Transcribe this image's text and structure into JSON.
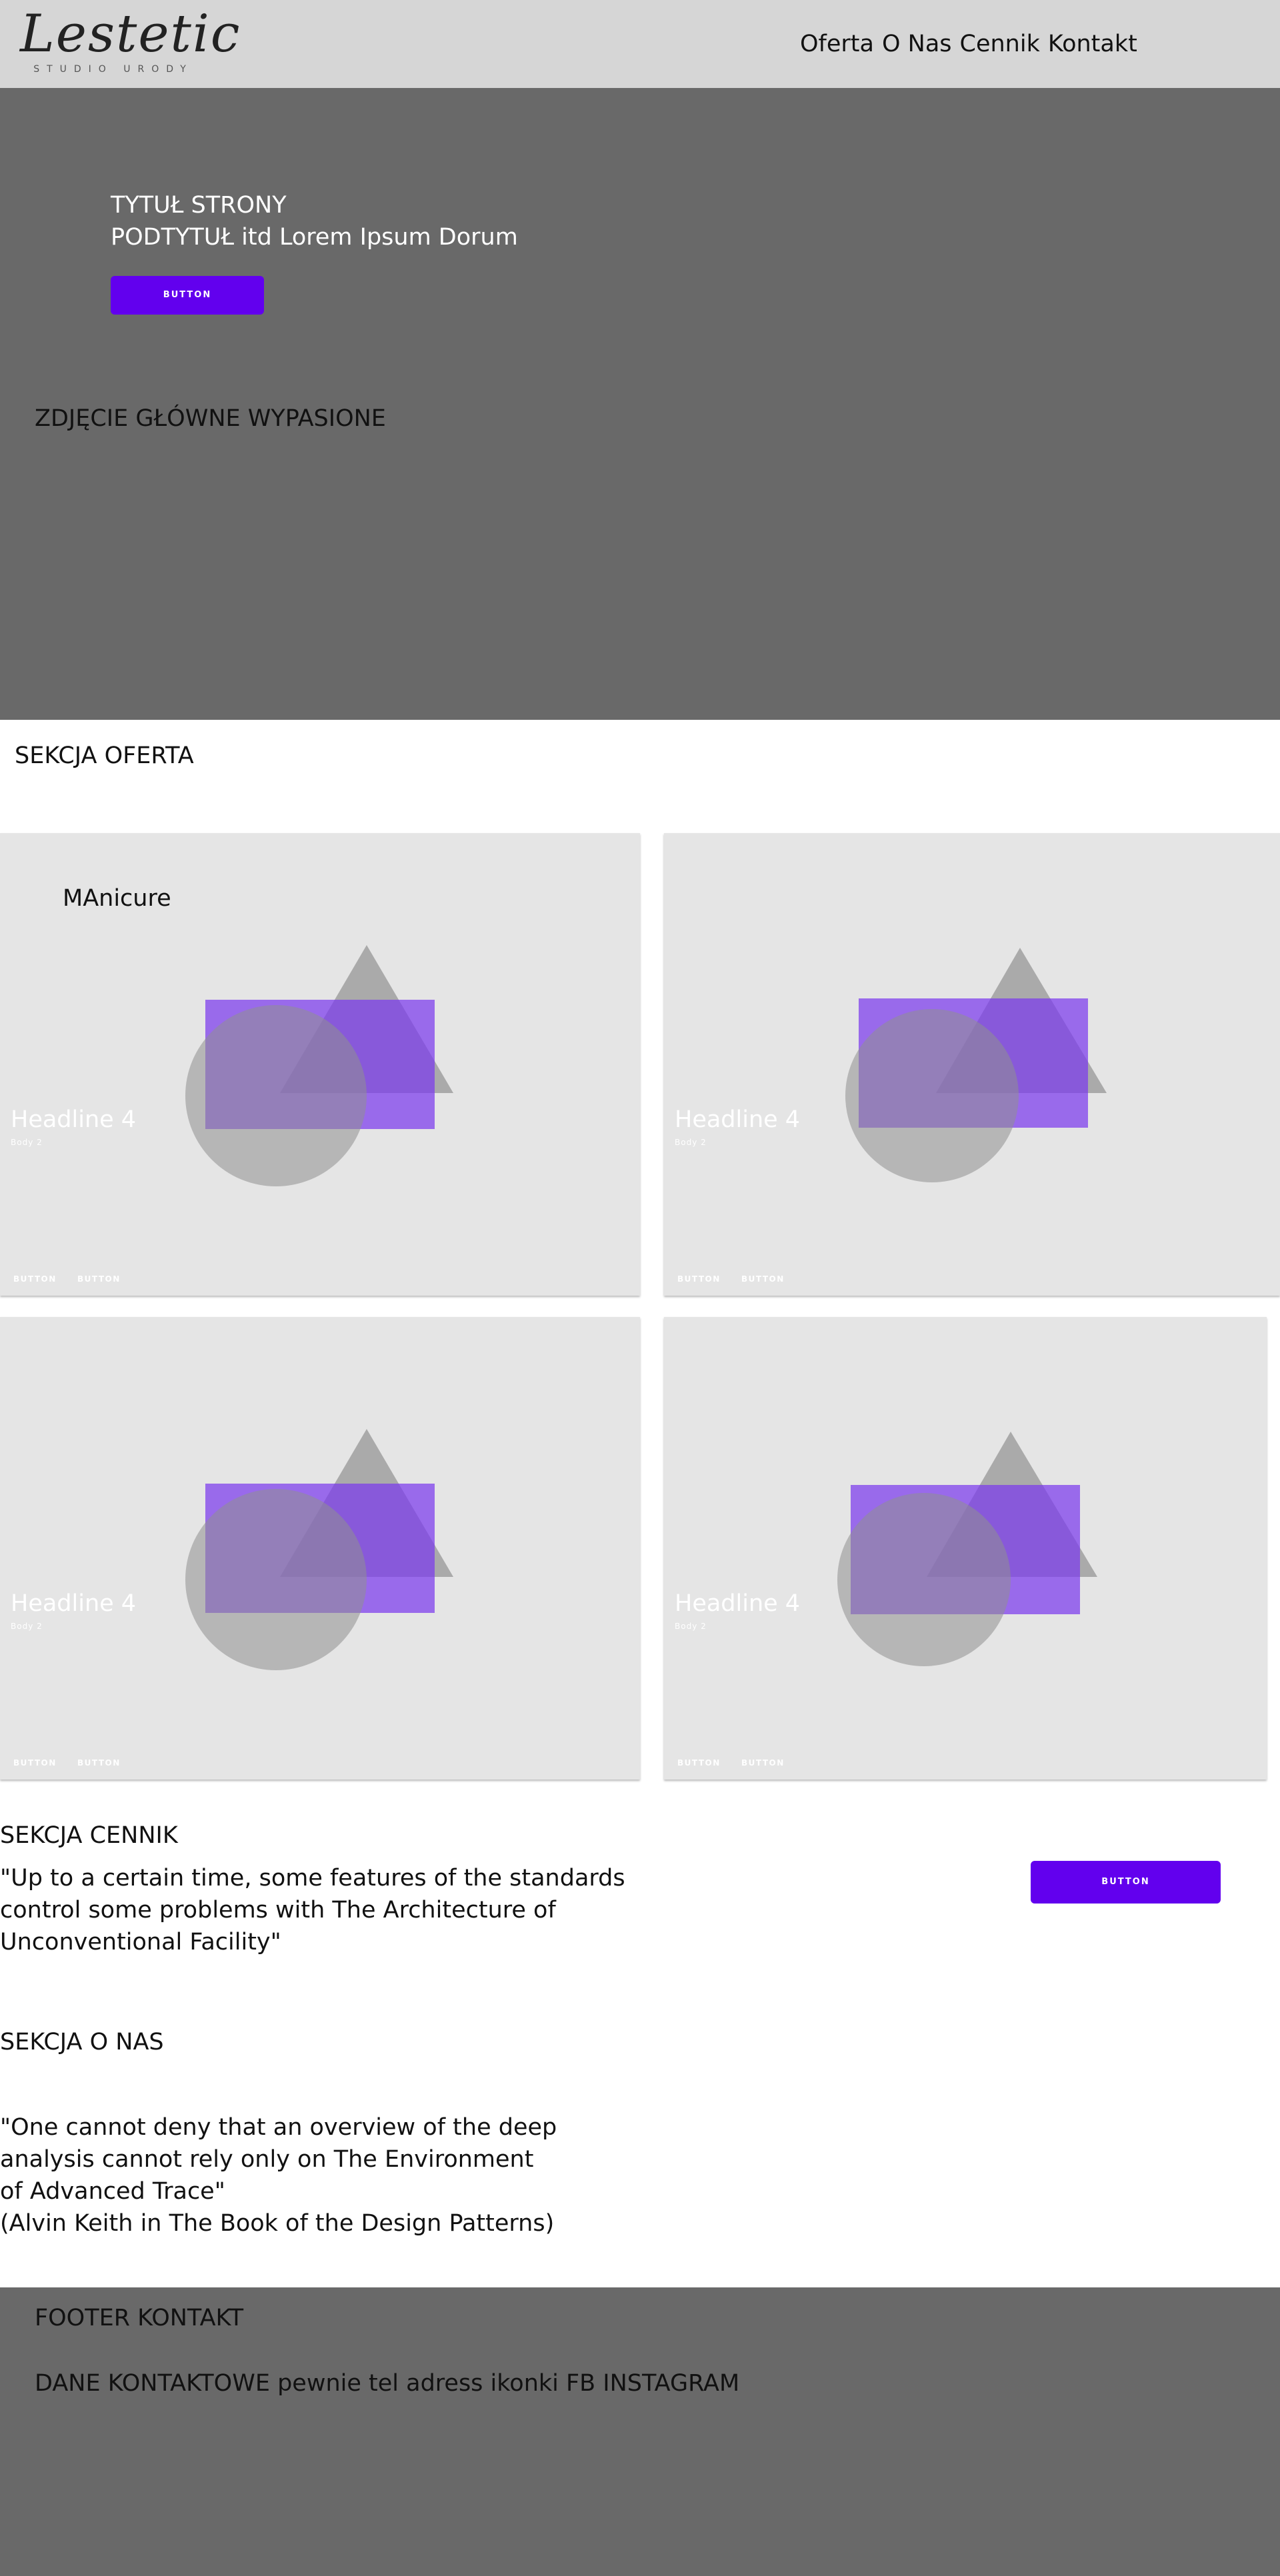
{
  "header": {
    "logo_text": "Lestetic",
    "logo_subtext": "STUDIO URODY",
    "nav": [
      "Oferta",
      "O Nas",
      "Cennik",
      "Kontakt"
    ]
  },
  "hero": {
    "title": "TYTUŁ STRONY",
    "subtitle": "PODTYTUŁ itd Lorem Ipsum Dorum",
    "button": "BUTTON",
    "photo_label": "ZDJĘCIE GŁÓWNE WYPASIONE"
  },
  "offer": {
    "title": "SEKCJA OFERTA",
    "cards": [
      {
        "label": "MAnicure",
        "headline": "Headline 4",
        "subtitle": "Body 2",
        "buttons": [
          "BUTTON",
          "BUTTON"
        ]
      },
      {
        "label": "",
        "headline": "Headline 4",
        "subtitle": "Body 2",
        "buttons": [
          "BUTTON",
          "BUTTON"
        ]
      },
      {
        "label": "",
        "headline": "Headline 4",
        "subtitle": "Body 2",
        "buttons": [
          "BUTTON",
          "BUTTON"
        ]
      },
      {
        "label": "",
        "headline": "Headline 4",
        "subtitle": "Body 2",
        "buttons": [
          "BUTTON",
          "BUTTON"
        ]
      }
    ]
  },
  "price": {
    "title": "SEKCJA CENNIK",
    "quote": "\"Up to a certain time, some features of the standards control some problems with The Architecture of Unconventional Facility\"",
    "button": "BUTTON"
  },
  "about": {
    "title": "SEKCJA O NAS",
    "quote": "\"One cannot deny that an overview of the deep analysis cannot rely only on The Environment of Advanced Trace\"",
    "author": "(Alvin Keith in The Book of the Design Patterns)"
  },
  "footer": {
    "title": "FOOTER KONTAKT",
    "details": "DANE KONTAKTOWE pewnie tel adress ikonki FB INSTAGRAM"
  },
  "colors": {
    "accent": "#6200ee",
    "header_bg": "#d6d6d6",
    "hero_bg": "#696969",
    "card_bg": "#e5e5e5",
    "placeholder_purple": "#7c3aed",
    "placeholder_gray": "#9e9e9e"
  },
  "icons": [
    "placeholder-shapes-icon"
  ]
}
